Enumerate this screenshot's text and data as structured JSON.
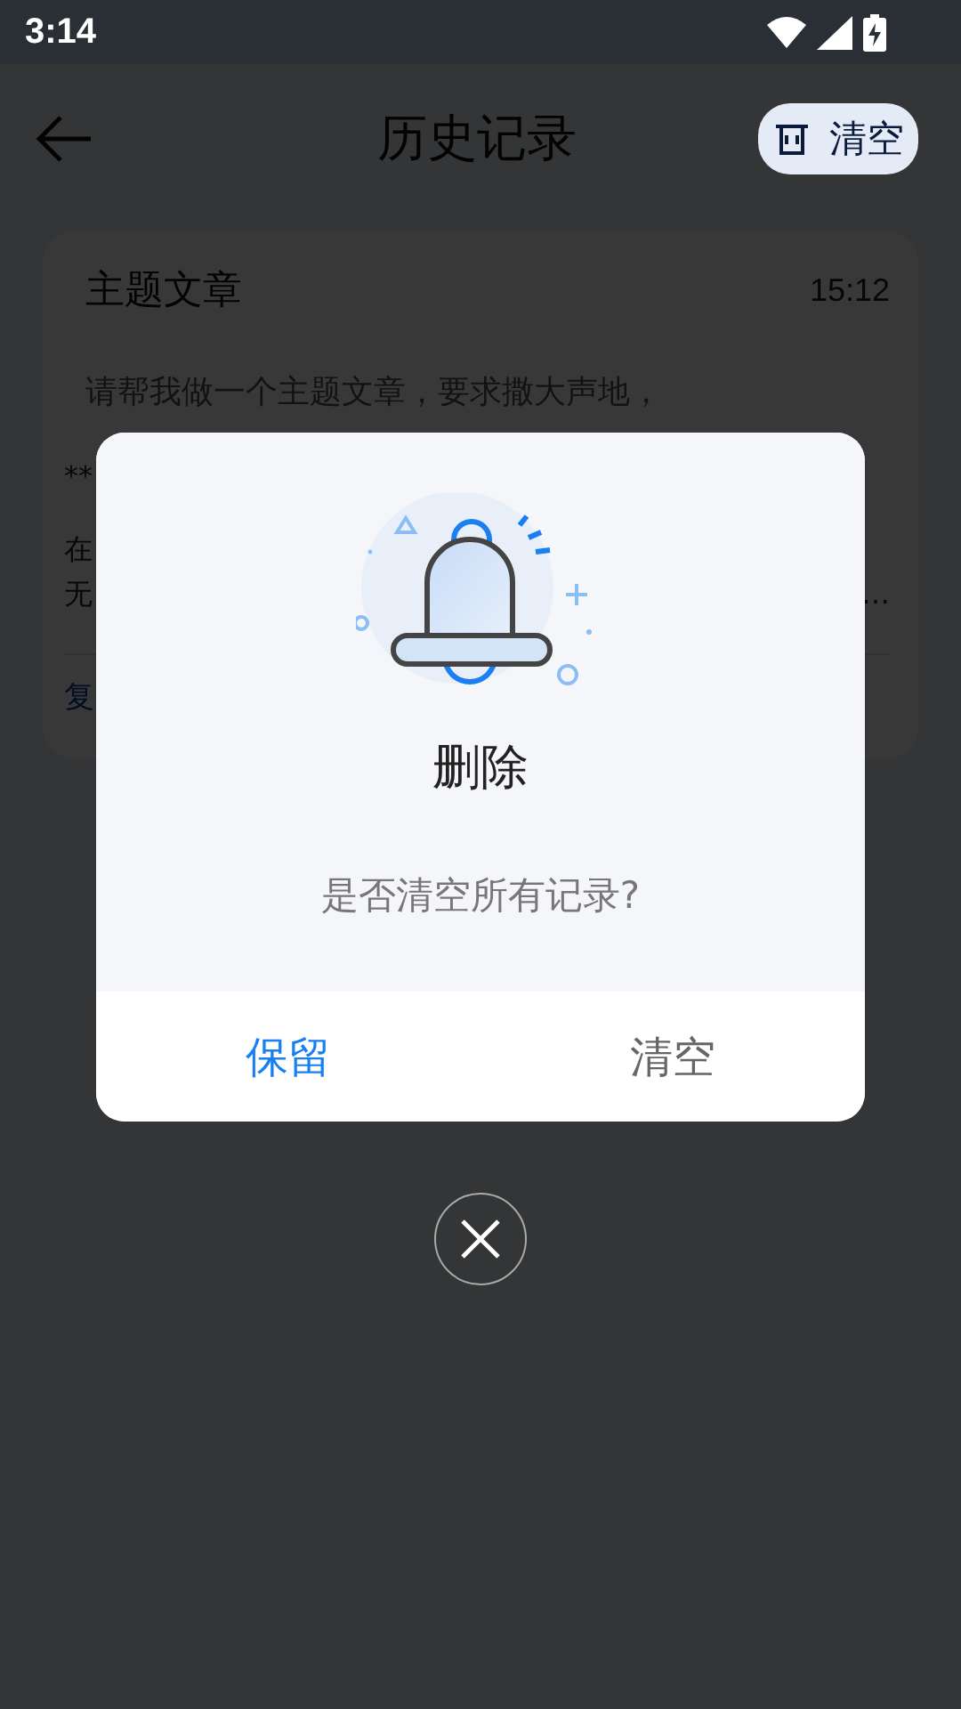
{
  "status_bar": {
    "time": "3:14"
  },
  "header": {
    "title": "历史记录",
    "clear_button": "清空"
  },
  "history": [
    {
      "title": "主题文章",
      "time": "15:12",
      "prompt": "请帮我做一个主题文章，要求撒大声地，",
      "lines": [
        {
          "left": "**"
        },
        {
          "left": "在"
        },
        {
          "left": "无",
          "right": "…"
        }
      ],
      "action": "复"
    }
  ],
  "dialog": {
    "title": "删除",
    "message": "是否清空所有记录?",
    "buttons": [
      {
        "label": "保留",
        "kind": "primary"
      },
      {
        "label": "清空",
        "kind": "secondary"
      }
    ]
  }
}
